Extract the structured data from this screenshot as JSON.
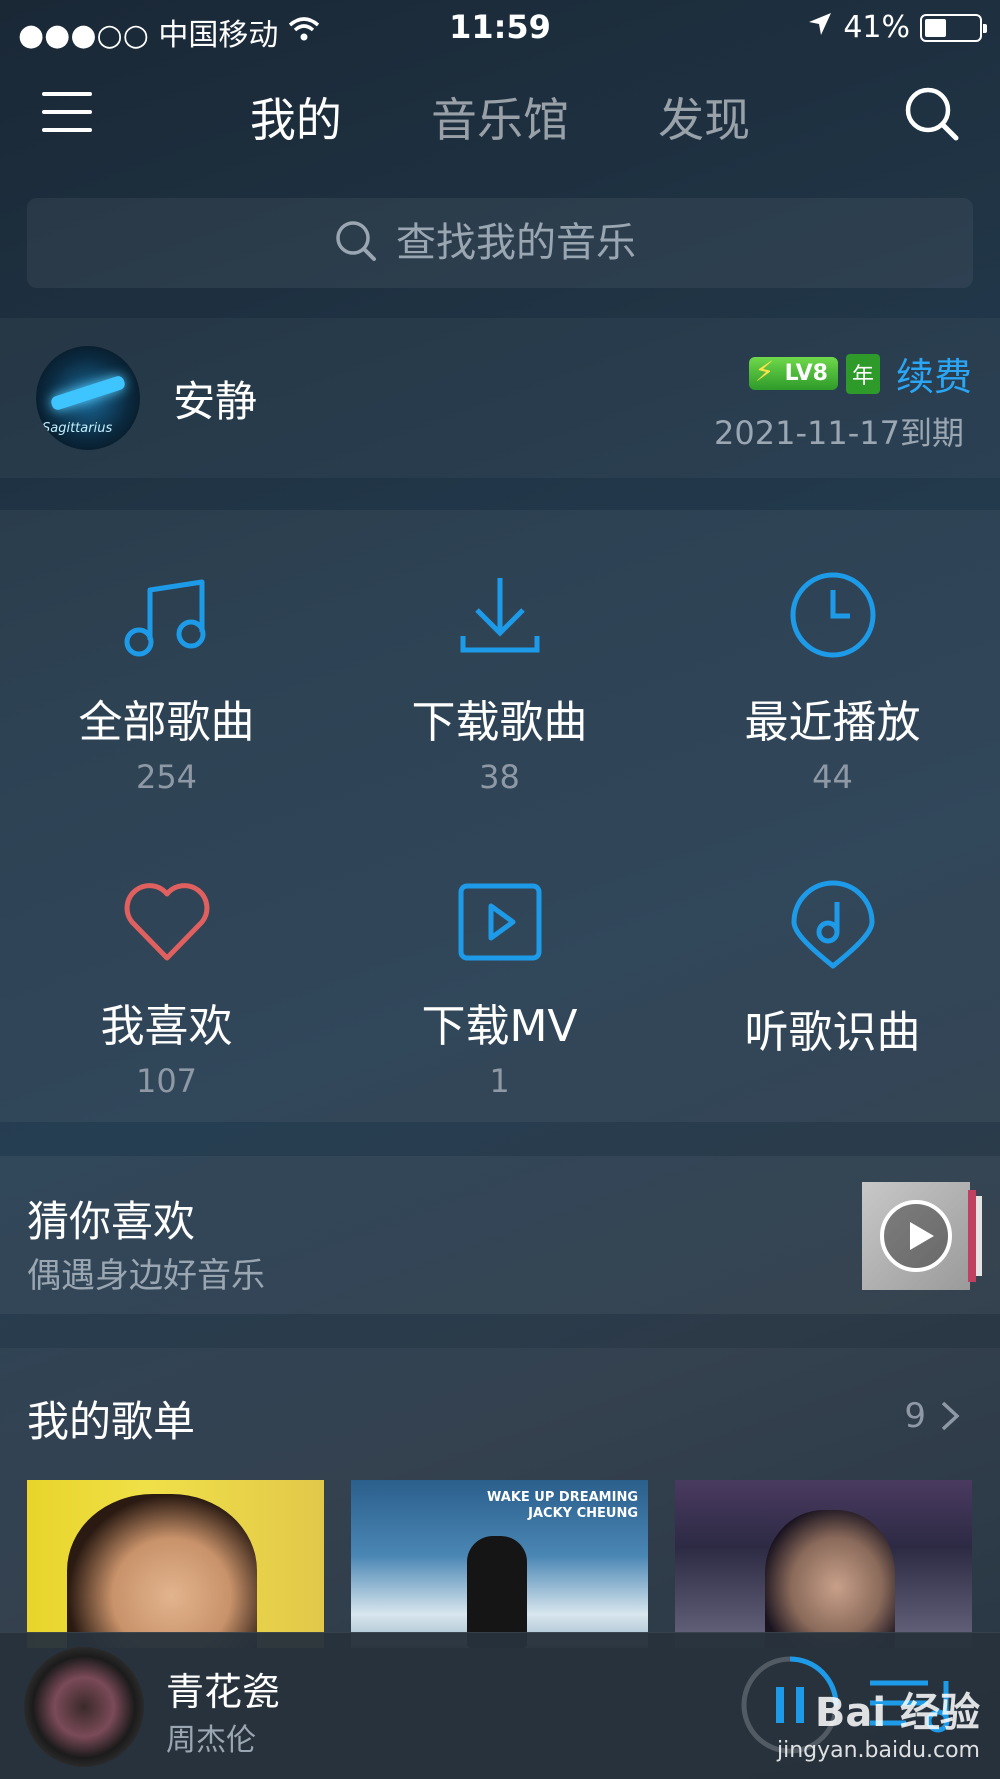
{
  "status_bar": {
    "carrier": "●●●○○ 中国移动",
    "time": "11:59",
    "battery": "41%",
    "battery_level": 0.41
  },
  "nav": {
    "tabs": [
      {
        "label": "我的",
        "active": true
      },
      {
        "label": "音乐馆",
        "active": false
      },
      {
        "label": "发现",
        "active": false
      }
    ]
  },
  "search": {
    "placeholder": "查找我的音乐"
  },
  "profile": {
    "avatar_text": "Sagittarius",
    "name": "安静",
    "level_badge": "LV8",
    "year_badge": "年",
    "renew_label": "续费",
    "expiry": "2021-11-17到期"
  },
  "grid": [
    {
      "label": "全部歌曲",
      "count": "254",
      "icon": "music-note-icon"
    },
    {
      "label": "下载歌曲",
      "count": "38",
      "icon": "download-icon"
    },
    {
      "label": "最近播放",
      "count": "44",
      "icon": "clock-icon"
    },
    {
      "label": "我喜欢",
      "count": "107",
      "icon": "heart-icon"
    },
    {
      "label": "下载MV",
      "count": "1",
      "icon": "video-icon"
    },
    {
      "label": "听歌识曲",
      "count": "",
      "icon": "recognize-icon"
    }
  ],
  "guess": {
    "title": "猜你喜欢",
    "subtitle": "偶遇身边好音乐"
  },
  "playlists": {
    "title": "我的歌单",
    "count": "9",
    "covers": [
      {
        "text": []
      },
      {
        "text": [
          "WAKE UP DREAMING",
          "JACKY CHEUNG"
        ]
      },
      {
        "text": []
      }
    ]
  },
  "player": {
    "song": "青花瓷",
    "artist": "周杰伦",
    "progress": 0.25
  },
  "watermark": {
    "brand": "Bai 经验",
    "url": "jingyan.baidu.com"
  },
  "colors": {
    "accent": "#2aa6f5",
    "heart": "#e06060",
    "vip_green": "#2e9a2a"
  }
}
